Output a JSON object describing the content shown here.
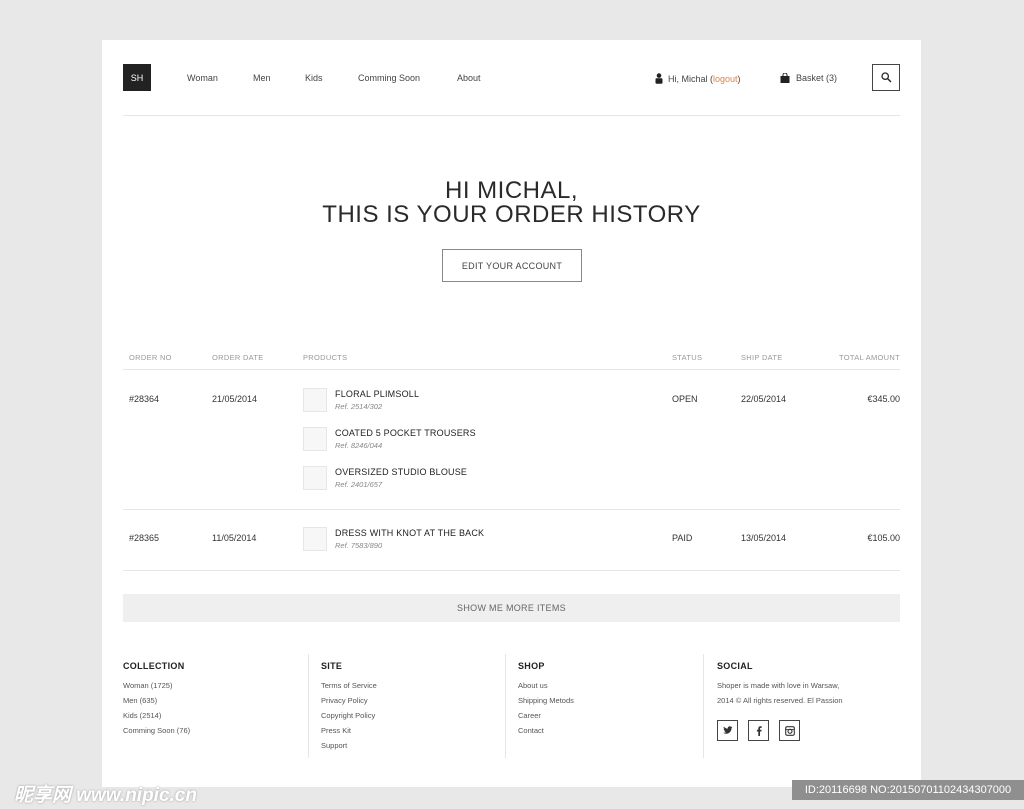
{
  "header": {
    "logo": "SH",
    "nav": [
      "Woman",
      "Men",
      "Kids",
      "Comming Soon",
      "About"
    ],
    "user_greeting": "Hi, Michal (",
    "user_logout": "logout",
    "user_close": ")",
    "basket": "Basket (3)",
    "icons": {
      "user": "user-icon",
      "basket": "bag-icon",
      "search": "search-icon"
    }
  },
  "hero": {
    "line1": "HI MICHAL,",
    "line2": "THIS IS YOUR ORDER HISTORY",
    "button": "EDIT YOUR ACCOUNT"
  },
  "table": {
    "headers": [
      "ORDER NO",
      "ORDER DATE",
      "PRODUCTS",
      "STATUS",
      "SHIP DATE",
      "TOTAL AMOUNT"
    ],
    "orders": [
      {
        "order_no": "#28364",
        "order_date": "21/05/2014",
        "status": "OPEN",
        "ship_date": "22/05/2014",
        "total": "€345.00",
        "products": [
          {
            "name": "FLORAL PLIMSOLL",
            "ref": "Ref. 2514/302"
          },
          {
            "name": "COATED 5 POCKET TROUSERS",
            "ref": "Ref. 8246/044"
          },
          {
            "name": "OVERSIZED STUDIO BLOUSE",
            "ref": "Ref. 2401/657"
          }
        ]
      },
      {
        "order_no": "#28365",
        "order_date": "11/05/2014",
        "status": "PAID",
        "ship_date": "13/05/2014",
        "total": "€105.00",
        "products": [
          {
            "name": "DRESS WITH KNOT AT THE BACK",
            "ref": "Ref. 7583/890"
          }
        ]
      }
    ],
    "more_button": "SHOW ME MORE ITEMS"
  },
  "footer": {
    "collection": {
      "title": "COLLECTION",
      "links": [
        "Woman (1725)",
        "Men (635)",
        "Kids (2514)",
        "Comming Soon (76)"
      ]
    },
    "site": {
      "title": "SITE",
      "links": [
        "Terms of Service",
        "Privacy Policy",
        "Copyright Policy",
        "Press Kit",
        "Support"
      ]
    },
    "shop": {
      "title": "SHOP",
      "links": [
        "About us",
        "Shipping Metods",
        "Career",
        "Contact"
      ]
    },
    "social": {
      "title": "SOCIAL",
      "text1": "Shoper is made with love in Warsaw,",
      "text2": "2014 © All rights reserved. El Passion",
      "icons": [
        "twitter-icon",
        "facebook-icon",
        "instagram-icon"
      ]
    }
  },
  "watermark": {
    "left": "昵享网 www.nipic.cn",
    "right": "ID:20116698 NO:20150701102434307000"
  }
}
